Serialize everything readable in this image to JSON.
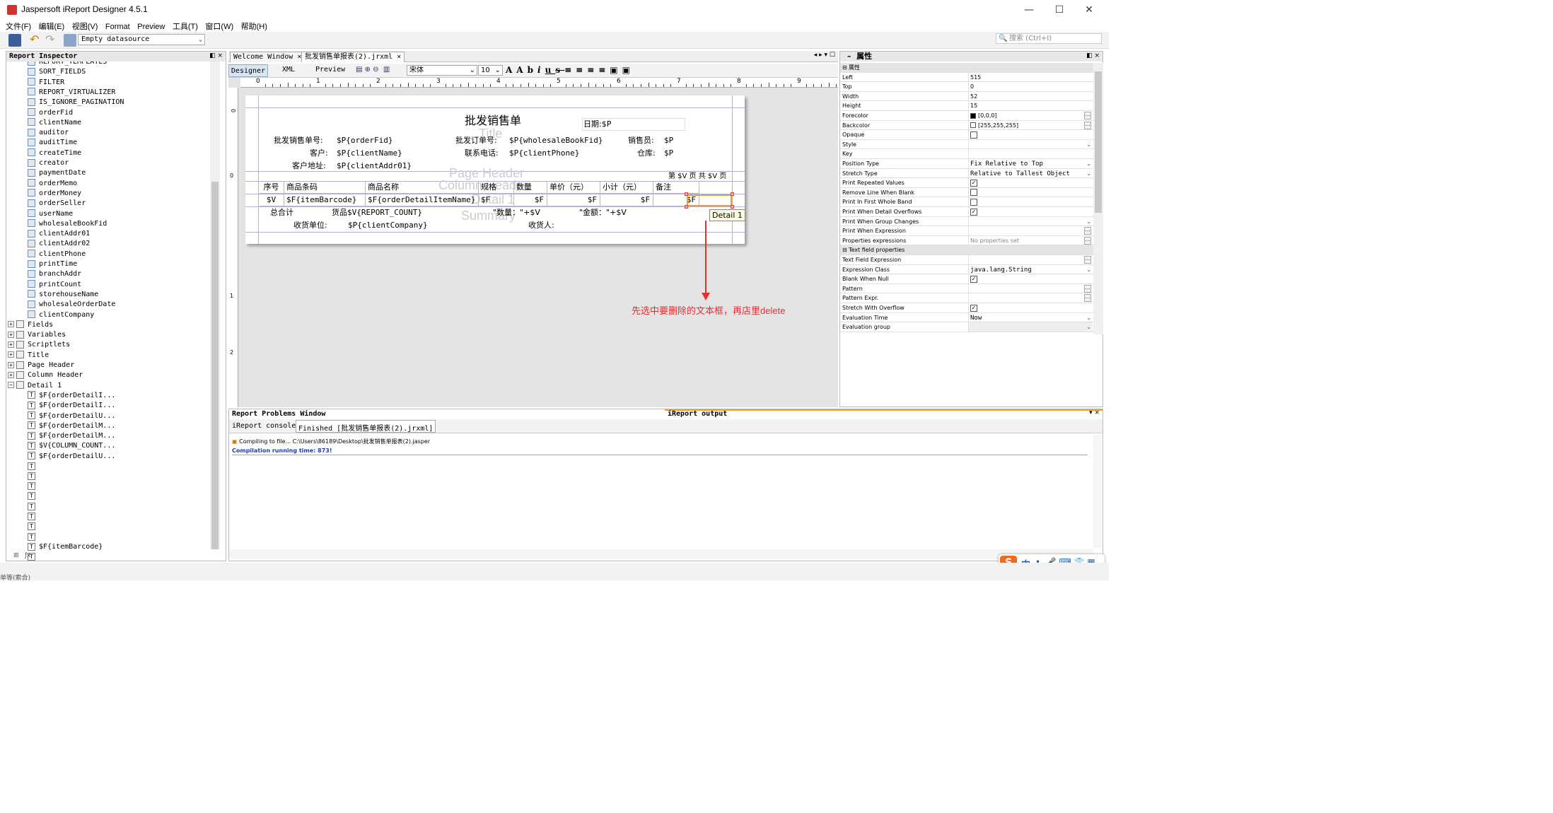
{
  "window": {
    "title": "Jaspersoft iReport Designer 4.5.1"
  },
  "menu": [
    "文件(F)",
    "编辑(E)",
    "视图(V)",
    "Format",
    "Preview",
    "工具(T)",
    "窗口(W)",
    "帮助(H)"
  ],
  "toolbar": {
    "datasource": "Empty datasource",
    "search_placeholder": "搜索 (Ctrl+I)"
  },
  "inspector": {
    "title": "Report Inspector",
    "params": [
      "REPORT_TEMPLATES",
      "SORT_FIELDS",
      "FILTER",
      "REPORT_VIRTUALIZER",
      "IS_IGNORE_PAGINATION",
      "orderFid",
      "clientName",
      "auditor",
      "auditTime",
      "createTime",
      "creator",
      "paymentDate",
      "orderMemo",
      "orderMoney",
      "orderSeller",
      "userName",
      "wholesaleBookFid",
      "clientAddr01",
      "clientAddr02",
      "clientPhone",
      "printTime",
      "branchAddr",
      "printCount",
      "storehouseName",
      "wholesaleOrderDate",
      "clientCompany"
    ],
    "sections": [
      "Fields",
      "Variables",
      "Scriptlets",
      "Title",
      "Page Header",
      "Column Header",
      "Detail 1"
    ],
    "detail_items": [
      "$F{orderDetailI...",
      "$F{orderDetailI...",
      "$F{orderDetailU...",
      "$F{orderDetailM...",
      "$F{orderDetailM...",
      "$V{COLUMN_COUNT...",
      "$F{orderDetailU..."
    ],
    "last_item": "$F{itemBarcode}"
  },
  "tabs": {
    "welcome": "Welcome Window",
    "file": "批发销售单报表(2).jrxml"
  },
  "designer_tabs": [
    "Designer",
    "XML",
    "Preview"
  ],
  "font": {
    "name": "宋体",
    "size": "10"
  },
  "ruler": [
    "0",
    "1",
    "2",
    "3",
    "4",
    "5",
    "6",
    "7",
    "8",
    "9"
  ],
  "report": {
    "title": "批发销售单",
    "date_label": "日期:$P",
    "row1": {
      "l1": "批发销售单号:",
      "v1": "$P{orderFid}",
      "l2": "批发订单号:",
      "v2": "$P{wholesaleBookFid}",
      "l3": "销售员:",
      "v3": "$P"
    },
    "row2": {
      "l1": "客户:",
      "v1": "$P{clientName}",
      "l2": "联系电话:",
      "v2": "$P{clientPhone}",
      "l3": "仓库:",
      "v3": "$P"
    },
    "row3": {
      "l1": "客户地址:",
      "v1": "$P{clientAddr01}"
    },
    "page_info": "第 $V 页  共 $V 页",
    "headers": [
      "序号",
      "商品条码",
      "商品名称",
      "规格",
      "数量",
      "单价（元）",
      "小计（元）",
      "备注"
    ],
    "detail": [
      "$V",
      "$F{itemBarcode}",
      "$F{orderDetailItemName}",
      "$F",
      "$F",
      "$F",
      "$F",
      "$F"
    ],
    "summary": {
      "total": "总合计",
      "count": "货品$V{REPORT_COUNT}",
      "qty": "\"数量：\"+$V",
      "amt": "\"金额：\"+$V"
    },
    "footer": {
      "l1": "收货单位:",
      "v1": "$P{clientCompany}",
      "l2": "收货人:"
    },
    "band_labels": [
      "Title",
      "Page Header",
      "Column Header",
      "Detail 1",
      "Summary"
    ],
    "tooltip": "Detail 1"
  },
  "annotation": "先选中要删除的文本框，再店里delete",
  "properties": {
    "title": "属性",
    "group1": "属性",
    "rows": [
      {
        "n": "Left",
        "v": "515"
      },
      {
        "n": "Top",
        "v": "0"
      },
      {
        "n": "Width",
        "v": "52"
      },
      {
        "n": "Height",
        "v": "15"
      },
      {
        "n": "Forecolor",
        "v": "[0,0,0]"
      },
      {
        "n": "Backcolor",
        "v": "[255,255,255]"
      },
      {
        "n": "Opaque",
        "v": ""
      },
      {
        "n": "Style",
        "v": ""
      },
      {
        "n": "Key",
        "v": ""
      },
      {
        "n": "Position Type",
        "v": "Fix Relative to Top"
      },
      {
        "n": "Stretch Type",
        "v": "Relative to Tallest Object"
      },
      {
        "n": "Print Repeated Values",
        "v": ""
      },
      {
        "n": "Remove Line When Blank",
        "v": ""
      },
      {
        "n": "Print In First Whole Band",
        "v": ""
      },
      {
        "n": "Print When Detail Overflows",
        "v": ""
      },
      {
        "n": "Print When Group Changes",
        "v": ""
      },
      {
        "n": "Print When Expression",
        "v": ""
      },
      {
        "n": "Properties expressions",
        "v": "No properties set"
      }
    ],
    "group2": "Text field properties",
    "rows2": [
      {
        "n": "Text Field Expression",
        "v": ""
      },
      {
        "n": "Expression Class",
        "v": "java.lang.String"
      },
      {
        "n": "Blank When Null",
        "v": ""
      },
      {
        "n": "Pattern",
        "v": ""
      },
      {
        "n": "Pattern Expr.",
        "v": ""
      },
      {
        "n": "Stretch With Overflow",
        "v": ""
      },
      {
        "n": "Evaluation Time",
        "v": "Now"
      },
      {
        "n": "Evaluation group",
        "v": ""
      }
    ]
  },
  "problems": {
    "title": "Report Problems Window",
    "output_title": "iReport output",
    "tab1": "iReport console",
    "tab2": "Finished [批发销售单报表(2).jrxml]",
    "line1": "Compiling to file... C:\\Users\\86189\\Desktop\\批发销售单报表(2).jasper",
    "line2": "Compilation running time: 873!"
  },
  "ime": {
    "lang": "中"
  },
  "status": {
    "left": "单等(索合)"
  },
  "colors": {
    "accent": "#1a5fb4",
    "annotation": "#e53030"
  }
}
